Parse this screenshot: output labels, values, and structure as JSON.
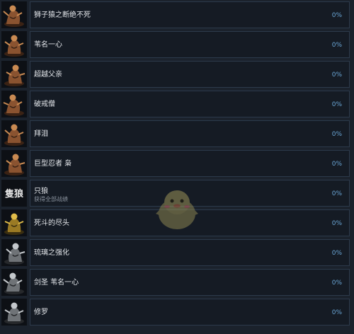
{
  "achievements": [
    {
      "name": "狮子猿之断绝不死",
      "desc": "",
      "percent": "0%",
      "icon": "lion-ape-icon",
      "tone": "bronze"
    },
    {
      "name": "苇名一心",
      "desc": "",
      "percent": "0%",
      "icon": "swordsman-icon",
      "tone": "bronze"
    },
    {
      "name": "超越父亲",
      "desc": "",
      "percent": "0%",
      "icon": "owl-warrior-icon",
      "tone": "bronze"
    },
    {
      "name": "破戒僧",
      "desc": "",
      "percent": "0%",
      "icon": "monk-icon",
      "tone": "bronze"
    },
    {
      "name": "拜泪",
      "desc": "",
      "percent": "0%",
      "icon": "serpent-icon",
      "tone": "bronze"
    },
    {
      "name": "巨型忍者 枭",
      "desc": "",
      "percent": "0%",
      "icon": "giant-ninja-icon",
      "tone": "bronze"
    },
    {
      "name": "只狼",
      "desc": "获得全部战绩",
      "percent": "0%",
      "icon": "sekiro-calligraphy-icon",
      "tone": "text"
    },
    {
      "name": "死斗的尽头",
      "desc": "",
      "percent": "0%",
      "icon": "gold-warrior-icon",
      "tone": "gold"
    },
    {
      "name": "琉璃之强化",
      "desc": "",
      "percent": "0%",
      "icon": "prosthetic-tool-icon",
      "tone": "silver"
    },
    {
      "name": "剑圣 苇名一心",
      "desc": "",
      "percent": "0%",
      "icon": "sword-saint-icon",
      "tone": "silver"
    },
    {
      "name": "修罗",
      "desc": "",
      "percent": "0%",
      "icon": "shura-icon",
      "tone": "silver"
    }
  ],
  "colors": {
    "background": "#1b222c",
    "panel": "#151b24",
    "panel_border": "#2c3a4b",
    "name_text": "#e3e6ea",
    "desc_text": "#8a939e",
    "percent_text": "#6aa6d6",
    "bronze": "#b5733f",
    "gold": "#c9a23a",
    "silver": "#9ea3a8"
  },
  "watermark": {
    "icon": "bird-mascot-watermark-icon"
  }
}
